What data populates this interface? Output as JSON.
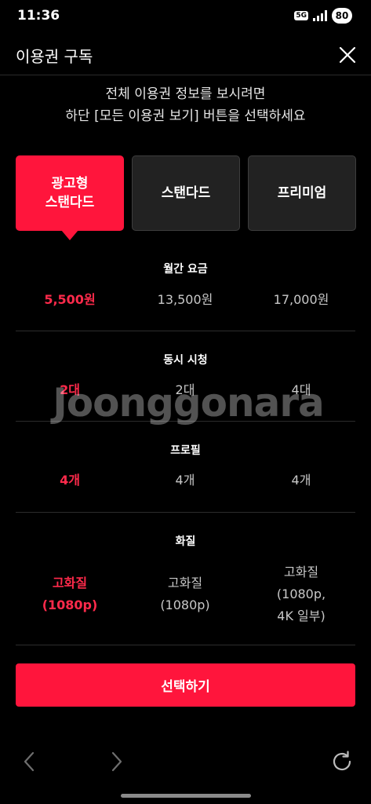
{
  "status_bar": {
    "time": "11:36",
    "network": "5G",
    "battery": "80"
  },
  "header": {
    "title": "이용권 구독",
    "close_icon": "close-icon"
  },
  "notice": {
    "line1": "전체 이용권 정보를 보시려면",
    "line2": "하단 [모든 이용권 보기] 버튼을 선택하세요"
  },
  "plans": [
    {
      "line1": "광고형",
      "line2": "스탠다드",
      "selected": true
    },
    {
      "line1": "스탠다드",
      "line2": "",
      "selected": false
    },
    {
      "line1": "프리미엄",
      "line2": "",
      "selected": false
    }
  ],
  "sections": {
    "price": {
      "title": "월간 요금",
      "values": [
        "5,500원",
        "13,500원",
        "17,000원"
      ]
    },
    "streams": {
      "title": "동시 시청",
      "values": [
        "2대",
        "2대",
        "4대"
      ]
    },
    "profiles": {
      "title": "프로필",
      "values": [
        "4개",
        "4개",
        "4개"
      ]
    },
    "quality": {
      "title": "화질",
      "values": [
        {
          "line1": "고화질",
          "line2": "(1080p)",
          "line3": ""
        },
        {
          "line1": "고화질",
          "line2": "(1080p)",
          "line3": ""
        },
        {
          "line1": "고화질",
          "line2": "(1080p,",
          "line3": "4K 일부)"
        }
      ]
    }
  },
  "watermark": "Joonggonara",
  "select_button": "선택하기",
  "colors": {
    "accent": "#ff153c",
    "background": "#000000",
    "card": "#222222"
  },
  "nav_icons": [
    "back-arrow-icon",
    "forward-arrow-icon",
    "refresh-icon"
  ]
}
